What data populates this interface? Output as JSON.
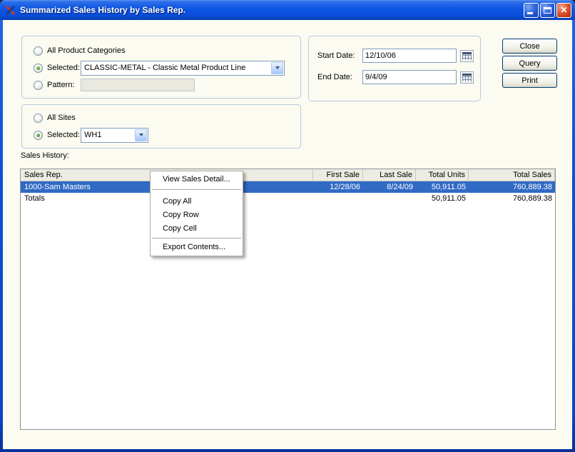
{
  "window": {
    "title": "Summarized Sales History by Sales Rep."
  },
  "icons": {
    "close_glyph": "✕"
  },
  "product_group": {
    "all_label": "All Product Categories",
    "selected_label": "Selected:",
    "selected_value": "CLASSIC-METAL - Classic Metal Product Line",
    "pattern_label": "Pattern:",
    "pattern_value": ""
  },
  "date_group": {
    "start_label": "Start Date:",
    "start_value": "12/10/06",
    "end_label": "End Date:",
    "end_value": "9/4/09"
  },
  "action_buttons": {
    "close": "Close",
    "query": "Query",
    "print": "Print"
  },
  "sites_group": {
    "all_label": "All Sites",
    "selected_label": "Selected:",
    "selected_value": "WH1"
  },
  "sales_history": {
    "label": "Sales History:",
    "columns": [
      "Sales Rep.",
      "First Sale",
      "Last Sale",
      "Total Units",
      "Total Sales"
    ],
    "rows": [
      {
        "rep": "1000-Sam Masters",
        "first_sale": "12/28/06",
        "last_sale": "8/24/09",
        "total_units": "50,911.05",
        "total_sales": "760,889.38",
        "selected": true
      },
      {
        "rep": "Totals",
        "first_sale": "",
        "last_sale": "",
        "total_units": "50,911.05",
        "total_sales": "760,889.38",
        "selected": false
      }
    ]
  },
  "context_menu": {
    "items": [
      "View Sales Detail...",
      "Copy All",
      "Copy Row",
      "Copy Cell",
      "Export Contents..."
    ]
  },
  "colors": {
    "titlebar": "#0A55E0",
    "window_frame": "#0B50D8",
    "content_background": "#FCFBF2",
    "selection": "#316AC5",
    "selection_text": "#FFFFFF",
    "field_border": "#7F9DB9",
    "groupbox_border": "#B4C8DE",
    "button_border": "#003C74",
    "menu_border": "#ACA899"
  }
}
